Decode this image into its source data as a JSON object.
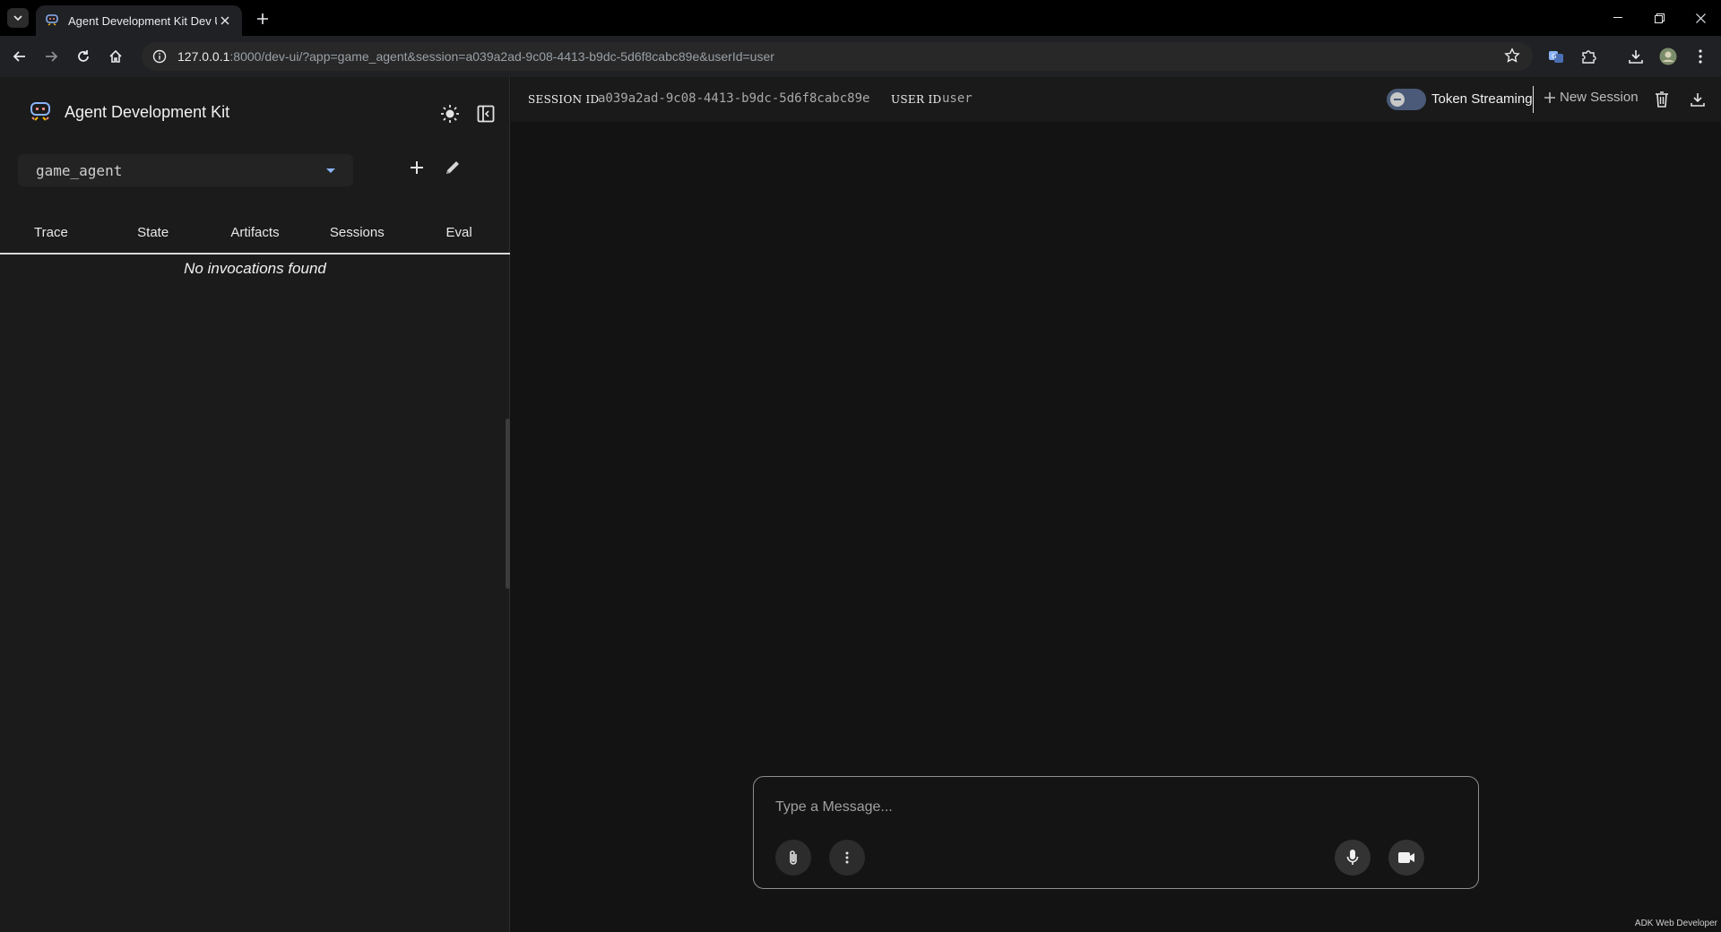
{
  "browser": {
    "tab_title": "Agent Development Kit Dev UI",
    "url_host": "127.0.0.1",
    "url_rest": ":8000/dev-ui/?app=game_agent&session=a039a2ad-9c08-4413-b9dc-5d6f8cabc89e&userId=user"
  },
  "sidepanel": {
    "brand_title": "Agent Development Kit",
    "agent_select_value": "game_agent",
    "tabs": [
      "Trace",
      "State",
      "Artifacts",
      "Sessions",
      "Eval"
    ],
    "empty_message": "No invocations found"
  },
  "session": {
    "session_id_label": "SESSION ID",
    "session_id": "a039a2ad-9c08-4413-b9dc-5d6f8cabc89e",
    "user_id_label": "USER ID",
    "user_id": "user",
    "token_streaming_label": "Token Streaming",
    "new_session_label": "New Session"
  },
  "composer": {
    "placeholder": "Type a Message..."
  },
  "footer": {
    "note": "ADK Web Developer"
  },
  "colors": {
    "accent": "#8ab4f8",
    "toggle_track": "#4a5a78",
    "panel_bg": "#1b1b1b",
    "main_bg": "#131313"
  },
  "icons": {
    "theme": "sun-icon",
    "panel": "panel-toggle-icon",
    "add": "plus-icon",
    "edit": "pencil-icon",
    "delete": "trash-icon",
    "download": "download-icon",
    "attach": "paperclip-icon",
    "more": "more-vert-icon",
    "mic": "mic-icon",
    "video": "videocam-icon"
  }
}
